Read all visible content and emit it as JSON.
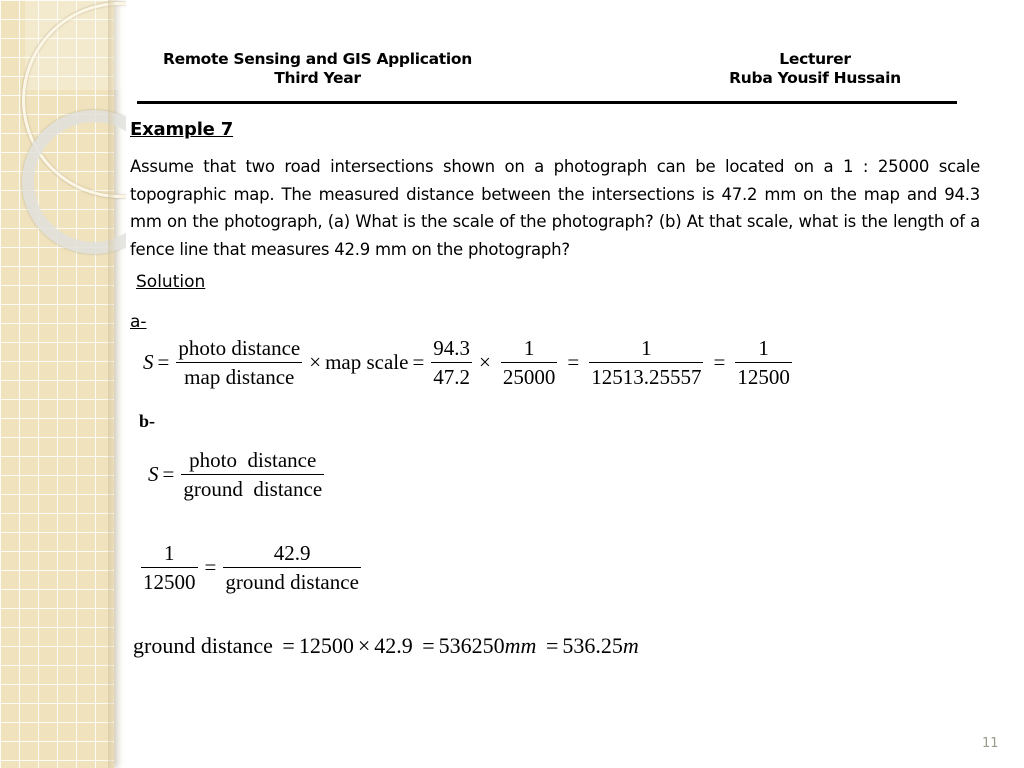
{
  "header": {
    "course_title": "Remote Sensing and GIS Application",
    "course_year": "Third Year",
    "lecturer_label": "Lecturer",
    "lecturer_name": "Ruba Yousif Hussain"
  },
  "example": {
    "title": "Example 7",
    "problem": "Assume that two road intersections shown on a photograph can be located on a 1 : 25000 scale topographic map. The measured distance between the intersections is 47.2 mm on the map and 94.3 mm on the photograph, (a) What is the scale of the photograph? (b) At that scale, what is the length of a fence line that measures 42.9 mm on the photograph?",
    "solution_label": "Solution"
  },
  "part_a": {
    "label": "a-",
    "lhs": "S",
    "eq": "=",
    "times": "×",
    "f1_num": "photo distance",
    "f1_den": "map distance",
    "map_scale": "map scale",
    "f2_num": "94.3",
    "f2_den": "47.2",
    "f3_num": "1",
    "f3_den": "25000",
    "f4_num": "1",
    "f4_den": "12513.25557",
    "f5_num": "1",
    "f5_den": "12500"
  },
  "part_b": {
    "label": "b-",
    "lhs": "S",
    "eq": "=",
    "f1_num": "photo  distance",
    "f1_den": "ground  distance",
    "f2_num": "1",
    "f2_den": "12500",
    "f3_num": "42.9",
    "f3_den": "ground distance",
    "final": {
      "lhs": "ground distance",
      "eq": "=",
      "times": "×",
      "v1": "12500",
      "v2": "42.9",
      "v3": "536250",
      "u3": "mm",
      "v4": "536.25",
      "u4": "m"
    }
  },
  "footer": {
    "page_number": "11"
  }
}
